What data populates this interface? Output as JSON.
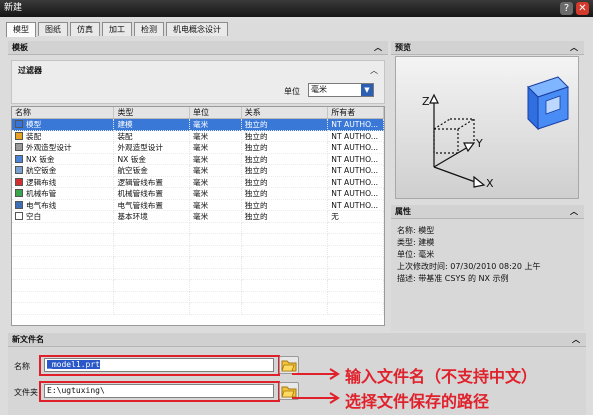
{
  "window": {
    "title": "新建"
  },
  "tabs": [
    "模型",
    "图纸",
    "仿真",
    "加工",
    "检测",
    "机电概念设计"
  ],
  "templates_header": "模板",
  "preview_header": "预览",
  "filter": {
    "title": "过滤器",
    "unit_label": "单位",
    "unit_value": "毫米"
  },
  "table": {
    "columns": [
      "名称",
      "类型",
      "单位",
      "关系",
      "所有者"
    ],
    "rows": [
      {
        "icon": "model-icon",
        "cells": [
          "模型",
          "建模",
          "毫米",
          "独立的",
          "NT AUTHO..."
        ]
      },
      {
        "icon": "assembly-icon",
        "cells": [
          "装配",
          "装配",
          "毫米",
          "独立的",
          "NT AUTHO..."
        ]
      },
      {
        "icon": "shape-studio-icon",
        "cells": [
          "外观造型设计",
          "外观造型设计",
          "毫米",
          "独立的",
          "NT AUTHO..."
        ]
      },
      {
        "icon": "sheet-metal-icon",
        "cells": [
          "NX 钣金",
          "NX 钣金",
          "毫米",
          "独立的",
          "NT AUTHO..."
        ]
      },
      {
        "icon": "aero-sheet-metal-icon",
        "cells": [
          "航空钣金",
          "航空钣金",
          "毫米",
          "独立的",
          "NT AUTHO..."
        ]
      },
      {
        "icon": "wiring-icon",
        "cells": [
          "逻辑布线",
          "逻辑管线布置",
          "毫米",
          "独立的",
          "NT AUTHO..."
        ]
      },
      {
        "icon": "piping-icon",
        "cells": [
          "机械布管",
          "机械管线布置",
          "毫米",
          "独立的",
          "NT AUTHO..."
        ]
      },
      {
        "icon": "electrical-icon",
        "cells": [
          "电气布线",
          "电气管线布置",
          "毫米",
          "独立的",
          "NT AUTHO..."
        ]
      },
      {
        "icon": "blank-icon",
        "cells": [
          "空白",
          "基本环境",
          "毫米",
          "独立的",
          "无"
        ]
      }
    ],
    "selected_index": 0
  },
  "properties": {
    "header": "属性",
    "lines": [
      "名称: 模型",
      "类型: 建模",
      "单位: 毫米",
      "上次修改时间: 07/30/2010 08:20 上午",
      "描述: 带基准 CSYS 的 NX 示例"
    ]
  },
  "new_file": {
    "header": "新文件名",
    "name_label": "名称",
    "name_value": "_model1.prt",
    "folder_label": "文件夹",
    "folder_value": "E:\\ugtuxing\\"
  },
  "annotations": {
    "name_hint": "输入文件名（不支持中文）",
    "folder_hint": "选择文件保存的路径"
  },
  "colors": {
    "selection": "#3a78d8",
    "annotation": "#e0212b"
  }
}
